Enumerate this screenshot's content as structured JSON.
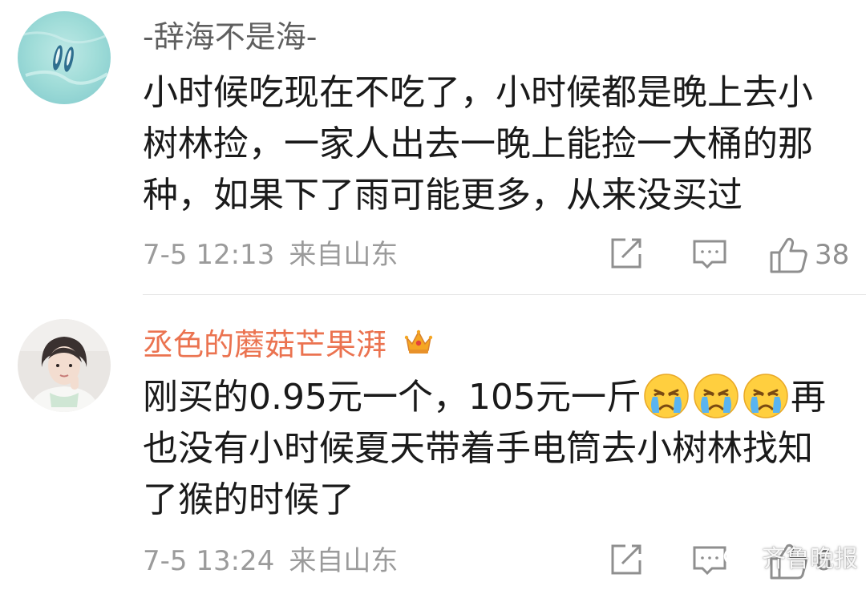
{
  "comments": [
    {
      "username": "-辞海不是海-",
      "text_lines": [
        "小时候吃现在不吃了，小时候都是晚上去小",
        "树林捡，一家人出去一晚上能捡一大桶的那",
        "种，如果下了雨可能更多，从来没买过"
      ],
      "time": "7-5 12:13",
      "source": "来自山东",
      "likes": "38",
      "icons": {
        "share": "share-edit-icon",
        "reply": "reply-comment-icon",
        "like": "thumb-up-icon"
      }
    },
    {
      "username": "丞色的蘑菇芒果湃",
      "badge": "crown-badge-icon",
      "line1_a": "刚买的0.95元一个，105元一斤",
      "line1_b": "再",
      "emoji": "crying-face-emoji",
      "line2": "也没有小时候夏天带着手电筒去小树林找知",
      "line3": "了猴的时候了",
      "time": "7-5 13:24",
      "source": "来自山东",
      "likes": "6",
      "icons": {
        "share": "share-edit-icon",
        "reply": "reply-comment-icon",
        "like": "thumb-up-icon"
      }
    }
  ],
  "watermark": {
    "text": "齐鲁晚报",
    "icon": "wechat-logo-icon"
  },
  "colors": {
    "vip_name": "#eb7350",
    "normal_name": "#5f5f5f",
    "meta": "#9b9b9b",
    "body_text": "#1a1a1a"
  }
}
